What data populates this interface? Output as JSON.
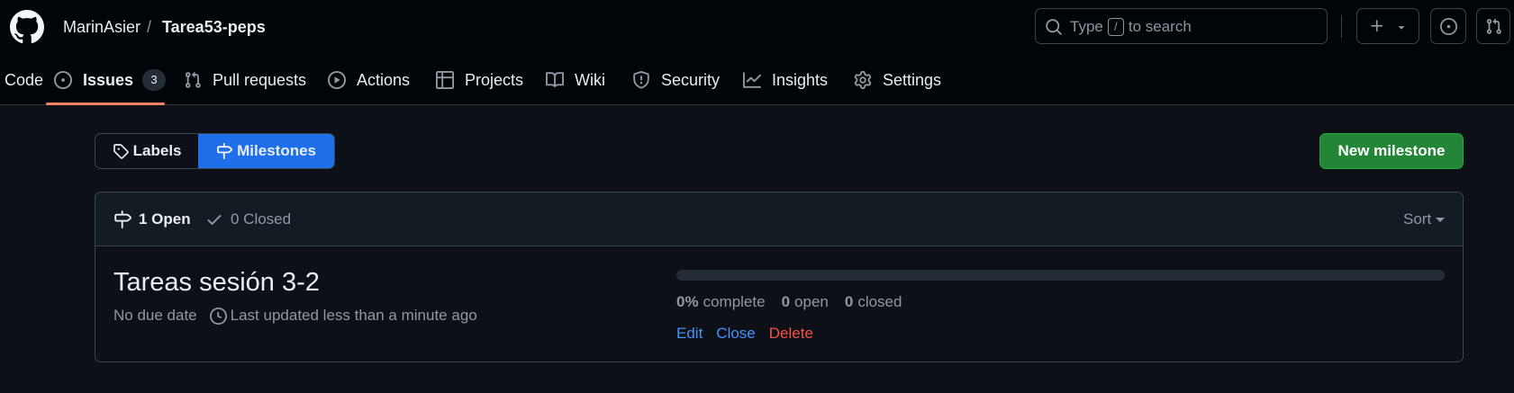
{
  "header": {
    "owner": "MarinAsier",
    "separator": "/",
    "repo": "Tarea53-peps",
    "search": {
      "prefix": "Type",
      "key": "/",
      "suffix": "to search"
    }
  },
  "repo_nav": {
    "items": [
      {
        "label": "Code",
        "icon": "code-icon"
      },
      {
        "label": "Issues",
        "icon": "issue-opened-icon",
        "count": "3",
        "active": true
      },
      {
        "label": "Pull requests",
        "icon": "git-pull-request-icon"
      },
      {
        "label": "Actions",
        "icon": "play-icon"
      },
      {
        "label": "Projects",
        "icon": "table-icon"
      },
      {
        "label": "Wiki",
        "icon": "book-icon"
      },
      {
        "label": "Security",
        "icon": "shield-icon"
      },
      {
        "label": "Insights",
        "icon": "graph-icon"
      },
      {
        "label": "Settings",
        "icon": "gear-icon"
      }
    ]
  },
  "subnav": {
    "labels": "Labels",
    "milestones": "Milestones",
    "active": "milestones"
  },
  "new_milestone_label": "New milestone",
  "milestones_list": {
    "open_count": "1 Open",
    "closed_count": "0 Closed",
    "sort_label": "Sort",
    "items": [
      {
        "title": "Tareas sesión 3-2",
        "due": "No due date",
        "updated": "Last updated less than a minute ago",
        "progress_percent": 0,
        "percent_value": "0%",
        "percent_label": "complete",
        "open_value": "0",
        "open_label": "open",
        "closed_value": "0",
        "closed_label": "closed",
        "edit_label": "Edit",
        "close_label": "Close",
        "delete_label": "Delete"
      }
    ]
  },
  "colors": {
    "background": "#0d1117",
    "header_background": "#010409",
    "accent_blue": "#1f6feb",
    "link_blue": "#4493f8",
    "primary_green": "#238636",
    "danger_red": "#f85149",
    "tab_underline": "#f78166"
  }
}
